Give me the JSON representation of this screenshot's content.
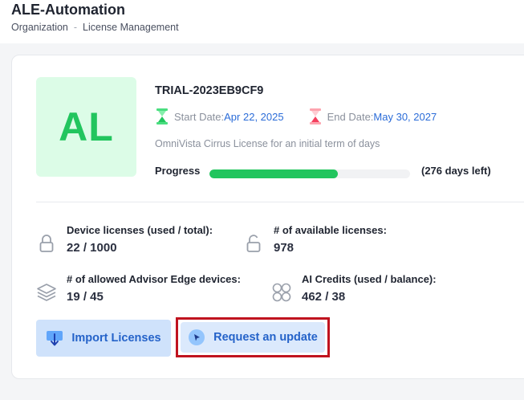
{
  "header": {
    "title": "ALE-Automation",
    "breadcrumb": [
      "Organization",
      "License Management"
    ],
    "breadcrumb_sep": "-"
  },
  "license": {
    "avatar_initials": "AL",
    "id": "TRIAL-2023EB9CF9",
    "start_label": "Start Date:",
    "start_value": "Apr 22, 2025",
    "end_label": "End Date:",
    "end_value": "May 30, 2027",
    "description": "OmniVista Cirrus License for an initial term of days",
    "progress_label": "Progress",
    "progress_fraction": 0.64,
    "days_left": "(276 days left)"
  },
  "stats": {
    "device_licenses_label": "Device licenses (used / total):",
    "device_licenses_value": "22 / 1000",
    "available_label": "# of available licenses:",
    "available_value": "978",
    "advisor_label": "# of allowed Advisor Edge devices:",
    "advisor_value": "19 / 45",
    "ai_label": "AI Credits (used / balance):",
    "ai_value": "462 / 38"
  },
  "actions": {
    "import_label": "Import Licenses",
    "update_label": "Request an update"
  },
  "colors": {
    "accent_green": "#22c55e",
    "accent_blue": "#2563c9",
    "highlight_red": "#c0131f"
  },
  "icons": {
    "start": "hourglass-green-icon",
    "end": "hourglass-red-icon",
    "lock": "lock-icon",
    "unlock": "unlock-icon",
    "layers": "layers-icon",
    "grid": "circles-grid-icon",
    "import": "download-icon",
    "update": "cursor-click-icon"
  }
}
